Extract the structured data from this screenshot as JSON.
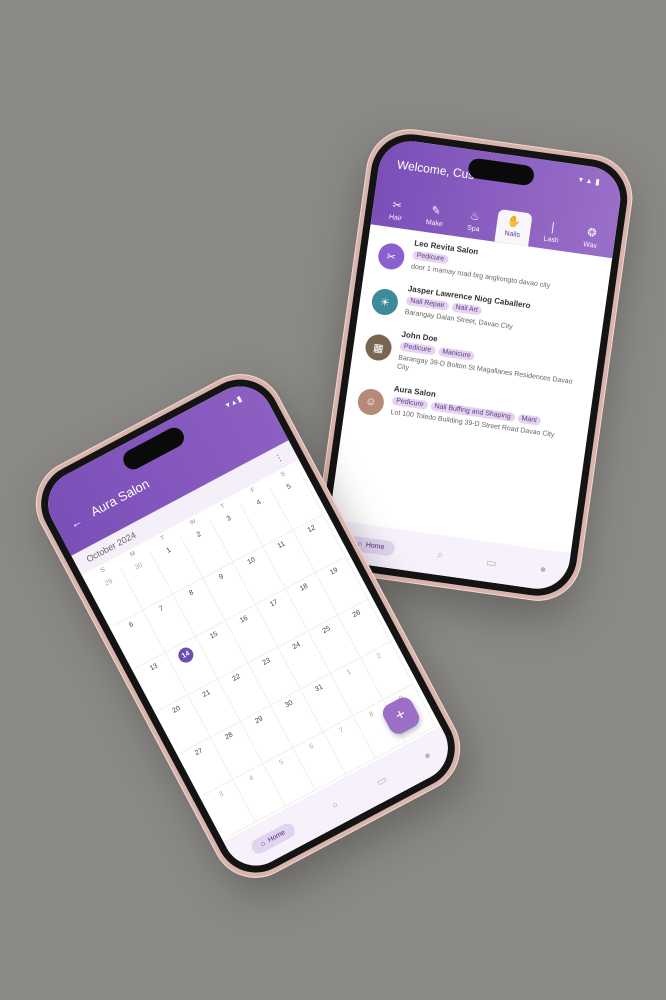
{
  "home": {
    "welcome": "Welcome, Cus",
    "categories": [
      {
        "label": "Hair",
        "icon": "hair-icon"
      },
      {
        "label": "Make",
        "icon": "makeup-icon"
      },
      {
        "label": "Spa",
        "icon": "spa-icon"
      },
      {
        "label": "Nails",
        "icon": "nails-icon"
      },
      {
        "label": "Lash",
        "icon": "lashes-icon"
      },
      {
        "label": "Wax",
        "icon": "wax-icon"
      }
    ],
    "salons": [
      {
        "name": "Leo Revita Salon",
        "tags": [
          "Pedicure"
        ],
        "address": "door 1 mamay road brg angliongto davao city"
      },
      {
        "name": "Jasper Lawrence Niog Caballero",
        "tags": [
          "Nail Repair",
          "Nail Art"
        ],
        "address": "Barangay Dalan Street, Davao City"
      },
      {
        "name": "John  Doe",
        "tags": [
          "Pedicure",
          "Manicure"
        ],
        "address": "Barangay 39-D Bolton St Magallanes Residences Davao City"
      },
      {
        "name": "Aura Salon",
        "tags": [
          "Pedicure",
          "Nail Buffing and Shaping",
          "Mani"
        ],
        "address": "Lot 100 Toledo Building 39-D Street Road Davao City"
      }
    ],
    "nav": {
      "home": "Home"
    }
  },
  "calendar": {
    "title": "Aura Salon",
    "month": "October 2024",
    "weekdays": [
      "S",
      "M",
      "T",
      "W",
      "T",
      "F",
      "S"
    ],
    "weeks": [
      [
        "29",
        "30",
        "1",
        "2",
        "3",
        "4",
        "5"
      ],
      [
        "6",
        "7",
        "8",
        "9",
        "10",
        "11",
        "12"
      ],
      [
        "13",
        "14",
        "15",
        "16",
        "17",
        "18",
        "19"
      ],
      [
        "20",
        "21",
        "22",
        "23",
        "24",
        "25",
        "26"
      ],
      [
        "27",
        "28",
        "29",
        "30",
        "31",
        "1",
        "2"
      ],
      [
        "3",
        "4",
        "5",
        "6",
        "7",
        "8",
        "9"
      ]
    ],
    "today": "14",
    "nav": {
      "home": "Home"
    },
    "fab": "+"
  },
  "colors": {
    "accent": "#7a4fb8",
    "tag_bg": "#e5d3f0",
    "background": "#8a8985"
  }
}
